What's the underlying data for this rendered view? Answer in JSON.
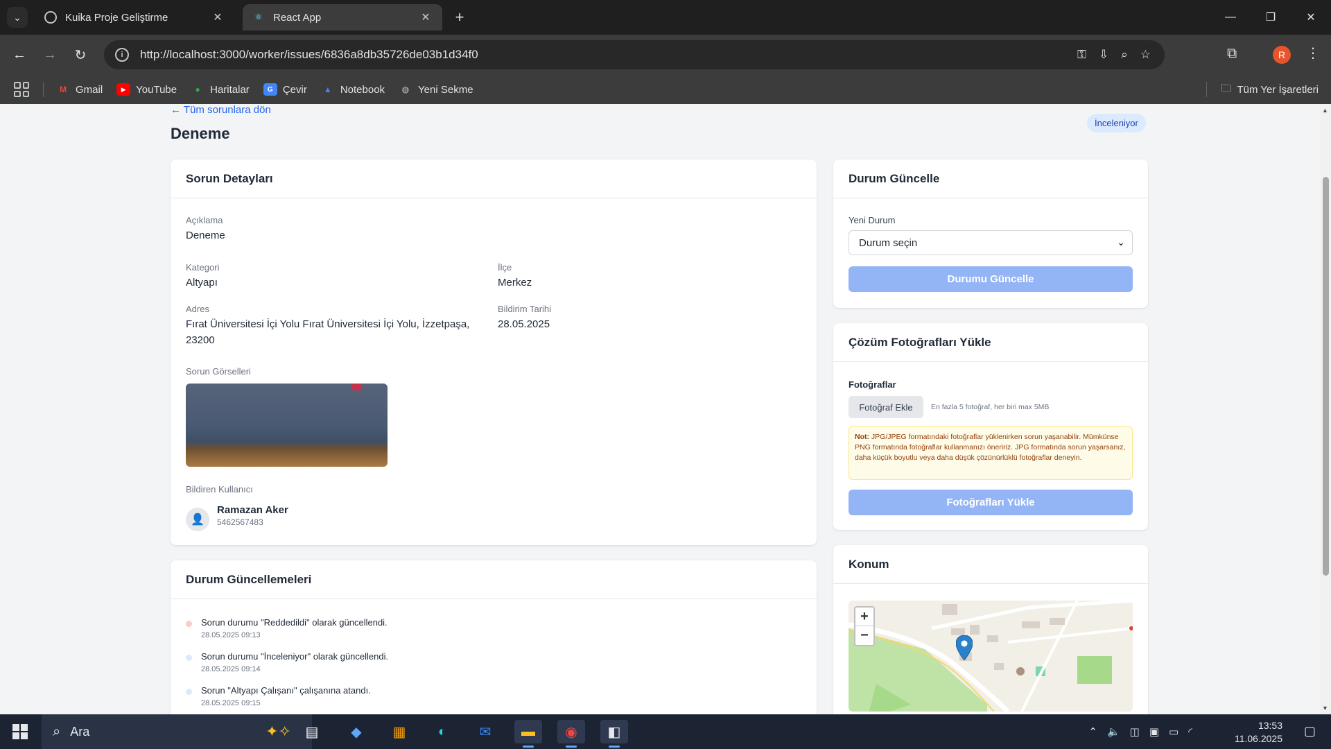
{
  "browser": {
    "tabs": [
      {
        "title": "Kuika Proje Geliştirme",
        "icon": "kuika-icon"
      },
      {
        "title": "React App",
        "icon": "react-icon"
      }
    ],
    "url": "http://localhost:3000/worker/issues/6836a8db35726de03b1d34f0",
    "profile_initial": "R",
    "bookmarks": [
      "Gmail",
      "YouTube",
      "Haritalar",
      "Çevir",
      "Notebook",
      "Yeni Sekme"
    ],
    "all_bookmarks": "Tüm Yer İşaretleri"
  },
  "page": {
    "back_link": "← Tüm sorunlara dön",
    "title": "Deneme",
    "status_badge": "İnceleniyor",
    "status_badge_color": "#dbeafe"
  },
  "details": {
    "heading": "Sorun Detayları",
    "description_label": "Açıklama",
    "description": "Deneme",
    "category_label": "Kategori",
    "category": "Altyapı",
    "district_label": "İlçe",
    "district": "Merkez",
    "address_label": "Adres",
    "address": "Fırat Üniversitesi İçi Yolu Fırat Üniversitesi İçi Yolu, İzzetpaşa, 23200",
    "date_label": "Bildirim Tarihi",
    "date": "28.05.2025",
    "images_label": "Sorun Görselleri",
    "reporter_label": "Bildiren Kullanıcı",
    "reporter_name": "Ramazan Aker",
    "reporter_phone": "5462567483"
  },
  "updates": {
    "heading": "Durum Güncellemeleri",
    "items": [
      {
        "text": "Sorun durumu \"Reddedildi\" olarak güncellendi.",
        "date": "28.05.2025 09:13",
        "color": "#fecaca"
      },
      {
        "text": "Sorun durumu \"İnceleniyor\" olarak güncellendi.",
        "date": "28.05.2025 09:14",
        "color": "#dbeafe"
      },
      {
        "text": "Sorun \"Altyapı Çalışanı\" çalışanına atandı.",
        "date": "28.05.2025 09:15",
        "color": "#dbeafe"
      }
    ]
  },
  "status_update": {
    "heading": "Durum Güncelle",
    "new_status_label": "Yeni Durum",
    "select_value": "Durum seçin",
    "button": "Durumu Güncelle"
  },
  "photo_upload": {
    "heading": "Çözüm Fotoğrafları Yükle",
    "photos_label": "Fotoğraflar",
    "add_button": "Fotoğraf Ekle",
    "hint": "En fazla 5 fotoğraf, her biri max 5MB",
    "note_label": "Not:",
    "note_text": "JPG/JPEG formatındaki fotoğraflar yüklenirken sorun yaşanabilir. Mümkünse PNG formatında fotoğraflar kullanmanızı öneririz. JPG formatında sorun yaşarsanız, daha küçük boyutlu veya daha düşük çözünürlüklü fotoğraflar deneyin.",
    "upload_button": "Fotoğrafları Yükle"
  },
  "location": {
    "heading": "Konum",
    "zoom_in": "+",
    "zoom_out": "−"
  },
  "taskbar": {
    "search_placeholder": "Ara",
    "time": "13:53",
    "date": "11.06.2025"
  }
}
